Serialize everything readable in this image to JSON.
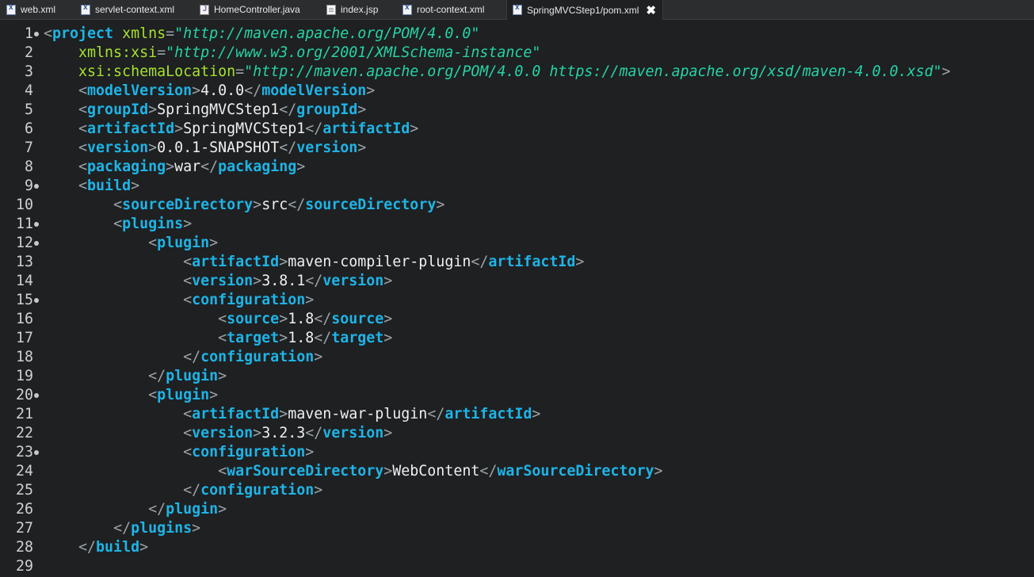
{
  "tabs": [
    {
      "label": "web.xml",
      "icon": "xml-file-icon"
    },
    {
      "label": "servlet-context.xml",
      "icon": "xml-file-icon"
    },
    {
      "label": "HomeController.java",
      "icon": "java-file-icon"
    },
    {
      "label": "index.jsp",
      "icon": "jsp-file-icon"
    },
    {
      "label": "root-context.xml",
      "icon": "xml-file-icon"
    },
    {
      "label": "SpringMVCStep1/pom.xml",
      "icon": "xml-file-icon",
      "active": true,
      "close": "✖"
    }
  ],
  "colors": {
    "background": "#1e2022",
    "tag": "#1eb4e6",
    "attribute": "#a6e22e",
    "string": "#26d4a6",
    "bracket": "#9aa3a8",
    "text": "#f0f0f0"
  },
  "lines": [
    {
      "n": "1",
      "fold": true,
      "indent": 0,
      "tokens": [
        [
          "b",
          "<"
        ],
        [
          "t",
          "project"
        ],
        [
          "x",
          " "
        ],
        [
          "a",
          "xmlns"
        ],
        [
          "b",
          "="
        ],
        [
          "s",
          "\"http://maven.apache.org/POM/4.0.0\""
        ]
      ]
    },
    {
      "n": "2",
      "indent": 1,
      "tokens": [
        [
          "a",
          "xmlns:xsi"
        ],
        [
          "b",
          "="
        ],
        [
          "s",
          "\"http://www.w3.org/2001/XMLSchema-instance\""
        ]
      ]
    },
    {
      "n": "3",
      "indent": 1,
      "tokens": [
        [
          "a",
          "xsi:schemaLocation"
        ],
        [
          "b",
          "="
        ],
        [
          "s",
          "\"http://maven.apache.org/POM/4.0.0 https://maven.apache.org/xsd/maven-4.0.0.xsd\""
        ],
        [
          "b",
          ">"
        ]
      ]
    },
    {
      "n": "4",
      "indent": 1,
      "tokens": [
        [
          "b",
          "<"
        ],
        [
          "t",
          "modelVersion"
        ],
        [
          "b",
          ">"
        ],
        [
          "x",
          "4.0.0"
        ],
        [
          "b",
          "</"
        ],
        [
          "t",
          "modelVersion"
        ],
        [
          "b",
          ">"
        ]
      ]
    },
    {
      "n": "5",
      "indent": 1,
      "tokens": [
        [
          "b",
          "<"
        ],
        [
          "t",
          "groupId"
        ],
        [
          "b",
          ">"
        ],
        [
          "x",
          "SpringMVCStep1"
        ],
        [
          "b",
          "</"
        ],
        [
          "t",
          "groupId"
        ],
        [
          "b",
          ">"
        ]
      ]
    },
    {
      "n": "6",
      "indent": 1,
      "tokens": [
        [
          "b",
          "<"
        ],
        [
          "t",
          "artifactId"
        ],
        [
          "b",
          ">"
        ],
        [
          "x",
          "SpringMVCStep1"
        ],
        [
          "b",
          "</"
        ],
        [
          "t",
          "artifactId"
        ],
        [
          "b",
          ">"
        ]
      ]
    },
    {
      "n": "7",
      "indent": 1,
      "tokens": [
        [
          "b",
          "<"
        ],
        [
          "t",
          "version"
        ],
        [
          "b",
          ">"
        ],
        [
          "x",
          "0.0.1-SNAPSHOT"
        ],
        [
          "b",
          "</"
        ],
        [
          "t",
          "version"
        ],
        [
          "b",
          ">"
        ]
      ]
    },
    {
      "n": "8",
      "indent": 1,
      "tokens": [
        [
          "b",
          "<"
        ],
        [
          "t",
          "packaging"
        ],
        [
          "b",
          ">"
        ],
        [
          "x",
          "war"
        ],
        [
          "b",
          "</"
        ],
        [
          "t",
          "packaging"
        ],
        [
          "b",
          ">"
        ]
      ]
    },
    {
      "n": "9",
      "fold": true,
      "indent": 1,
      "tokens": [
        [
          "b",
          "<"
        ],
        [
          "t",
          "build"
        ],
        [
          "b",
          ">"
        ]
      ]
    },
    {
      "n": "10",
      "indent": 2,
      "tokens": [
        [
          "b",
          "<"
        ],
        [
          "t",
          "sourceDirectory"
        ],
        [
          "b",
          ">"
        ],
        [
          "x",
          "src"
        ],
        [
          "b",
          "</"
        ],
        [
          "t",
          "sourceDirectory"
        ],
        [
          "b",
          ">"
        ]
      ]
    },
    {
      "n": "11",
      "fold": true,
      "indent": 2,
      "tokens": [
        [
          "b",
          "<"
        ],
        [
          "t",
          "plugins"
        ],
        [
          "b",
          ">"
        ]
      ]
    },
    {
      "n": "12",
      "fold": true,
      "indent": 3,
      "tokens": [
        [
          "b",
          "<"
        ],
        [
          "t",
          "plugin"
        ],
        [
          "b",
          ">"
        ]
      ]
    },
    {
      "n": "13",
      "indent": 4,
      "tokens": [
        [
          "b",
          "<"
        ],
        [
          "t",
          "artifactId"
        ],
        [
          "b",
          ">"
        ],
        [
          "x",
          "maven-compiler-plugin"
        ],
        [
          "b",
          "</"
        ],
        [
          "t",
          "artifactId"
        ],
        [
          "b",
          ">"
        ]
      ]
    },
    {
      "n": "14",
      "indent": 4,
      "tokens": [
        [
          "b",
          "<"
        ],
        [
          "t",
          "version"
        ],
        [
          "b",
          ">"
        ],
        [
          "x",
          "3.8.1"
        ],
        [
          "b",
          "</"
        ],
        [
          "t",
          "version"
        ],
        [
          "b",
          ">"
        ]
      ]
    },
    {
      "n": "15",
      "fold": true,
      "indent": 4,
      "tokens": [
        [
          "b",
          "<"
        ],
        [
          "t",
          "configuration"
        ],
        [
          "b",
          ">"
        ]
      ]
    },
    {
      "n": "16",
      "indent": 5,
      "tokens": [
        [
          "b",
          "<"
        ],
        [
          "t",
          "source"
        ],
        [
          "b",
          ">"
        ],
        [
          "x",
          "1.8"
        ],
        [
          "b",
          "</"
        ],
        [
          "t",
          "source"
        ],
        [
          "b",
          ">"
        ]
      ]
    },
    {
      "n": "17",
      "indent": 5,
      "tokens": [
        [
          "b",
          "<"
        ],
        [
          "t",
          "target"
        ],
        [
          "b",
          ">"
        ],
        [
          "x",
          "1.8"
        ],
        [
          "b",
          "</"
        ],
        [
          "t",
          "target"
        ],
        [
          "b",
          ">"
        ]
      ]
    },
    {
      "n": "18",
      "indent": 4,
      "tokens": [
        [
          "b",
          "</"
        ],
        [
          "t",
          "configuration"
        ],
        [
          "b",
          ">"
        ]
      ]
    },
    {
      "n": "19",
      "indent": 3,
      "tokens": [
        [
          "b",
          "</"
        ],
        [
          "t",
          "plugin"
        ],
        [
          "b",
          ">"
        ]
      ]
    },
    {
      "n": "20",
      "fold": true,
      "indent": 3,
      "tokens": [
        [
          "b",
          "<"
        ],
        [
          "t",
          "plugin"
        ],
        [
          "b",
          ">"
        ]
      ]
    },
    {
      "n": "21",
      "indent": 4,
      "tokens": [
        [
          "b",
          "<"
        ],
        [
          "t",
          "artifactId"
        ],
        [
          "b",
          ">"
        ],
        [
          "x",
          "maven-war-plugin"
        ],
        [
          "b",
          "</"
        ],
        [
          "t",
          "artifactId"
        ],
        [
          "b",
          ">"
        ]
      ]
    },
    {
      "n": "22",
      "indent": 4,
      "tokens": [
        [
          "b",
          "<"
        ],
        [
          "t",
          "version"
        ],
        [
          "b",
          ">"
        ],
        [
          "x",
          "3.2.3"
        ],
        [
          "b",
          "</"
        ],
        [
          "t",
          "version"
        ],
        [
          "b",
          ">"
        ]
      ]
    },
    {
      "n": "23",
      "fold": true,
      "indent": 4,
      "tokens": [
        [
          "b",
          "<"
        ],
        [
          "t",
          "configuration"
        ],
        [
          "b",
          ">"
        ]
      ]
    },
    {
      "n": "24",
      "indent": 5,
      "tokens": [
        [
          "b",
          "<"
        ],
        [
          "t",
          "warSourceDirectory"
        ],
        [
          "b",
          ">"
        ],
        [
          "x",
          "WebContent"
        ],
        [
          "b",
          "</"
        ],
        [
          "t",
          "warSourceDirectory"
        ],
        [
          "b",
          ">"
        ]
      ]
    },
    {
      "n": "25",
      "indent": 4,
      "tokens": [
        [
          "b",
          "</"
        ],
        [
          "t",
          "configuration"
        ],
        [
          "b",
          ">"
        ]
      ]
    },
    {
      "n": "26",
      "indent": 3,
      "tokens": [
        [
          "b",
          "</"
        ],
        [
          "t",
          "plugin"
        ],
        [
          "b",
          ">"
        ]
      ]
    },
    {
      "n": "27",
      "indent": 2,
      "tokens": [
        [
          "b",
          "</"
        ],
        [
          "t",
          "plugins"
        ],
        [
          "b",
          ">"
        ]
      ]
    },
    {
      "n": "28",
      "indent": 1,
      "tokens": [
        [
          "b",
          "</"
        ],
        [
          "t",
          "build"
        ],
        [
          "b",
          ">"
        ]
      ]
    },
    {
      "n": "29",
      "indent": 0,
      "tokens": []
    }
  ]
}
